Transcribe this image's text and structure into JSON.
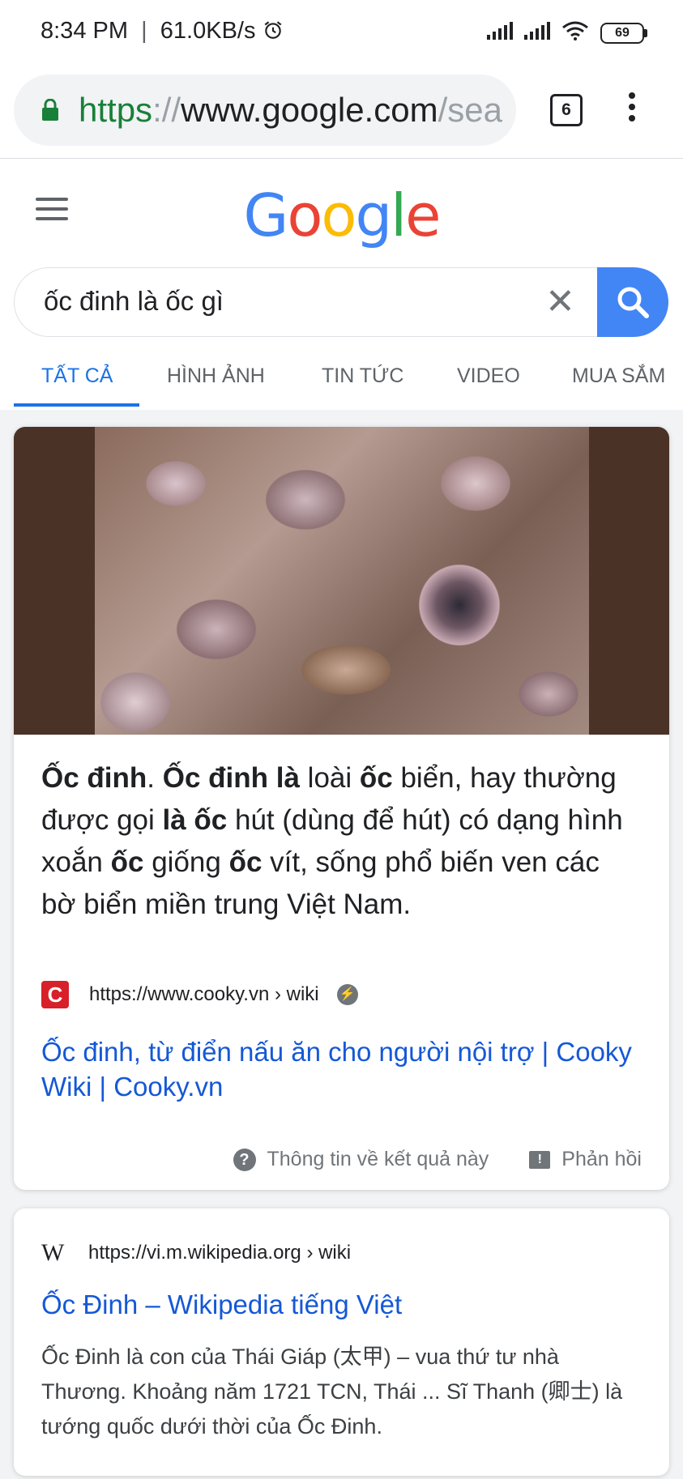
{
  "status_bar": {
    "time": "8:34 PM",
    "network_speed": "61.0KB/s",
    "battery": "69"
  },
  "browser": {
    "url_scheme": "https",
    "url_sep": "://",
    "url_host": "www.google.com",
    "url_rest": "/sea",
    "tab_count": "6"
  },
  "google": {
    "logo": "Google",
    "query": "ốc đinh là ốc gì",
    "tabs": [
      "TẤT CẢ",
      "HÌNH ẢNH",
      "TIN TỨC",
      "VIDEO",
      "MUA SẮM"
    ]
  },
  "featured": {
    "snippet_parts": [
      "Ốc đinh",
      ". ",
      "Ốc đinh là",
      " loài ",
      "ốc",
      " biển, hay thường được gọi ",
      "là ốc",
      " hút (dùng để hút) có dạng hình xoắn ",
      "ốc",
      " giống ",
      "ốc",
      " vít, sống phổ biến ven các bờ biển miền trung Việt Nam."
    ],
    "favicon_letter": "C",
    "source_url": "https://www.cooky.vn › wiki",
    "title": "Ốc đinh, từ điển nấu ăn cho người nội trợ | Cooky Wiki | Cooky.vn",
    "about_label": "Thông tin về kết quả này",
    "feedback_label": "Phản hồi"
  },
  "wiki_result": {
    "favicon": "W",
    "source_url": "https://vi.m.wikipedia.org › wiki",
    "title": "Ốc Đinh – Wikipedia tiếng Việt",
    "description": "Ốc Đinh là con của Thái Giáp (太甲) – vua thứ tư nhà Thương. Khoảng năm 1721 TCN, Thái ... Sĩ Thanh (卿士) là tướng quốc dưới thời của Ốc Đinh."
  },
  "colors": {
    "link": "#1558d6",
    "accent": "#1a73e8",
    "search_button": "#4285f4",
    "secure_green": "#188038"
  }
}
